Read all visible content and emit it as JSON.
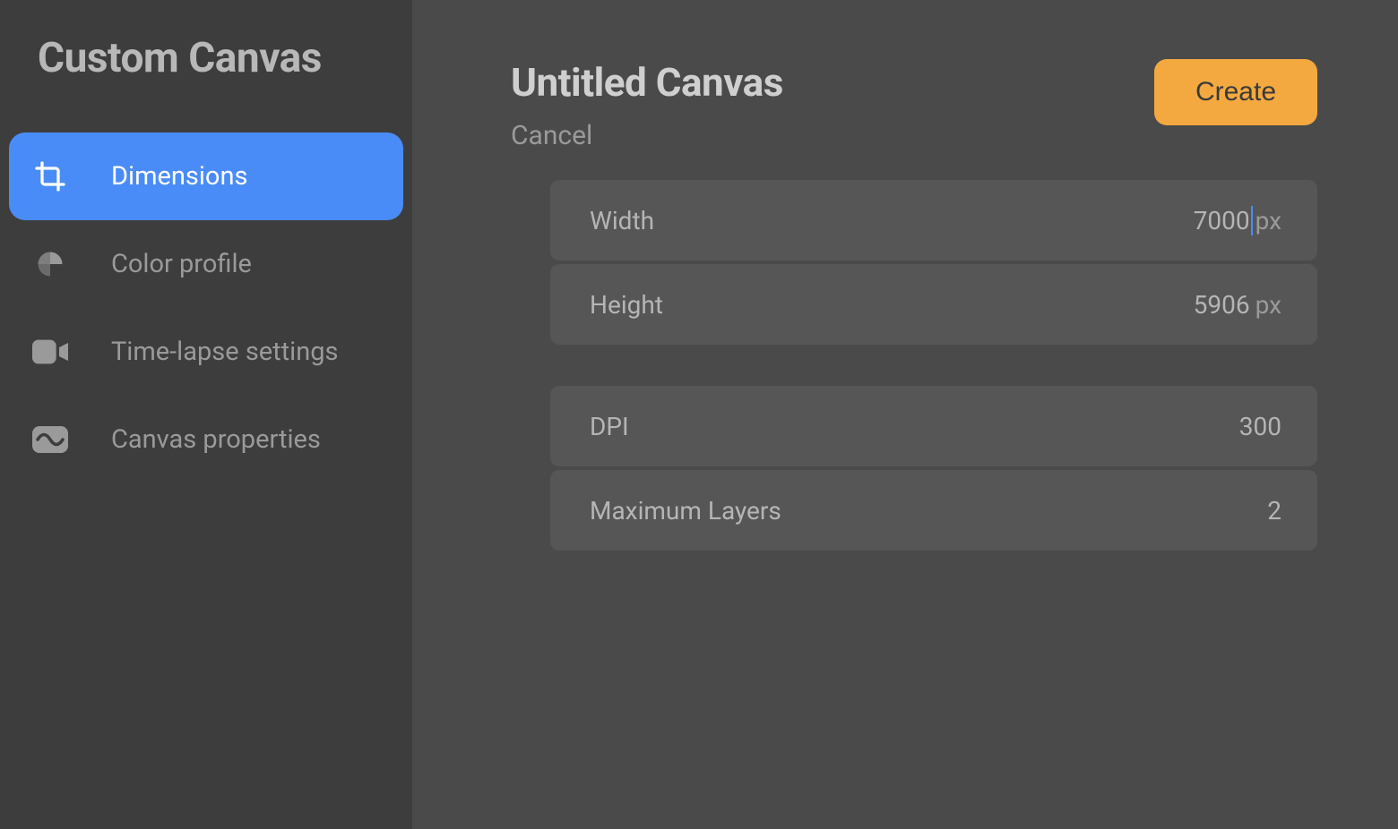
{
  "sidebar": {
    "title": "Custom Canvas",
    "items": [
      {
        "label": "Dimensions",
        "active": true,
        "icon": "crop-icon"
      },
      {
        "label": "Color profile",
        "active": false,
        "icon": "palette-icon"
      },
      {
        "label": "Time-lapse settings",
        "active": false,
        "icon": "video-icon"
      },
      {
        "label": "Canvas properties",
        "active": false,
        "icon": "wave-icon"
      }
    ]
  },
  "header": {
    "title": "Untitled Canvas",
    "cancel_label": "Cancel",
    "create_label": "Create"
  },
  "fields": {
    "width": {
      "label": "Width",
      "value": "7000",
      "unit": "px",
      "caret": true
    },
    "height": {
      "label": "Height",
      "value": "5906",
      "unit": "px"
    },
    "dpi": {
      "label": "DPI",
      "value": "300"
    },
    "max_layers": {
      "label": "Maximum Layers",
      "value": "2"
    }
  },
  "colors": {
    "accent": "#4a8cf7",
    "create_button": "#f4a940"
  }
}
